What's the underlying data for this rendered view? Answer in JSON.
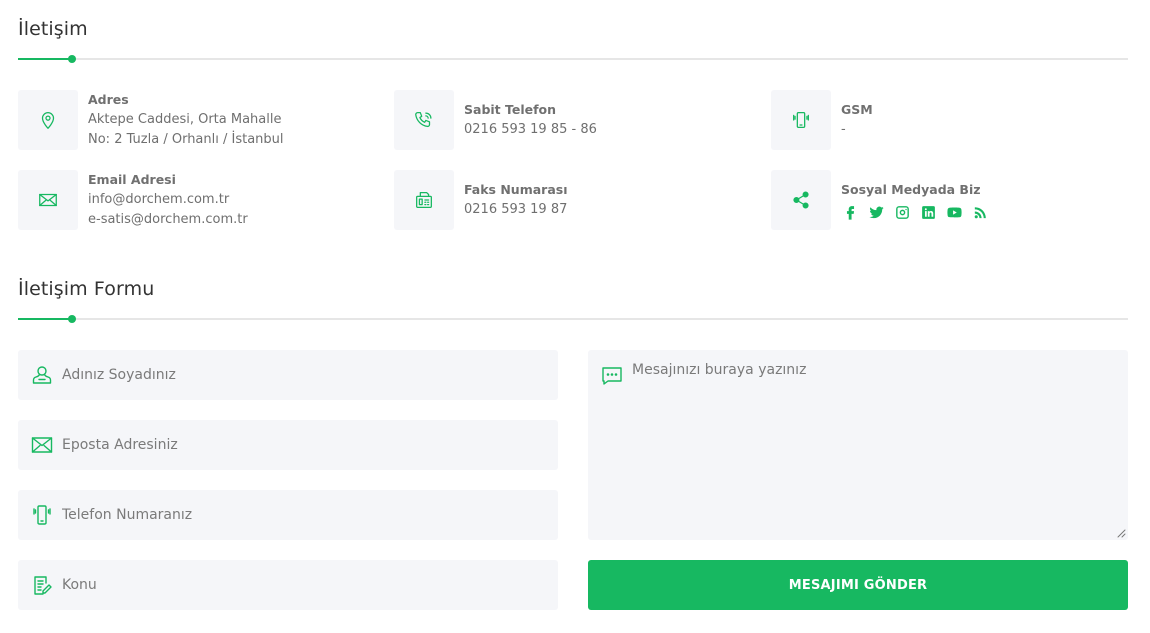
{
  "contact": {
    "title": "İletişim",
    "address": {
      "label": "Adres",
      "line1": "Aktepe Caddesi, Orta Mahalle",
      "line2": "No: 2 Tuzla / Orhanlı / İstanbul"
    },
    "landline": {
      "label": "Sabit Telefon",
      "value": "0216 593 19 85 - 86"
    },
    "gsm": {
      "label": "GSM",
      "value": "-"
    },
    "email": {
      "label": "Email Adresi",
      "line1": "info@dorchem.com.tr",
      "line2": "e-satis@dorchem.com.tr"
    },
    "fax": {
      "label": "Faks Numarası",
      "value": "0216 593 19 87"
    },
    "social": {
      "label": "Sosyal Medyada Biz",
      "icons": [
        "facebook-icon",
        "twitter-icon",
        "instagram-icon",
        "linkedin-icon",
        "youtube-icon",
        "rss-icon"
      ]
    }
  },
  "form": {
    "title": "İletişim Formu",
    "name_placeholder": "Adınız Soyadınız",
    "email_placeholder": "Eposta Adresiniz",
    "phone_placeholder": "Telefon Numaranız",
    "subject_placeholder": "Konu",
    "message_placeholder": "Mesajınızı buraya yazınız",
    "submit_label": "MESAJIMI GÖNDER"
  },
  "colors": {
    "accent": "#17b861",
    "field_bg": "#f5f6f9",
    "divider": "#e6e6e6"
  }
}
